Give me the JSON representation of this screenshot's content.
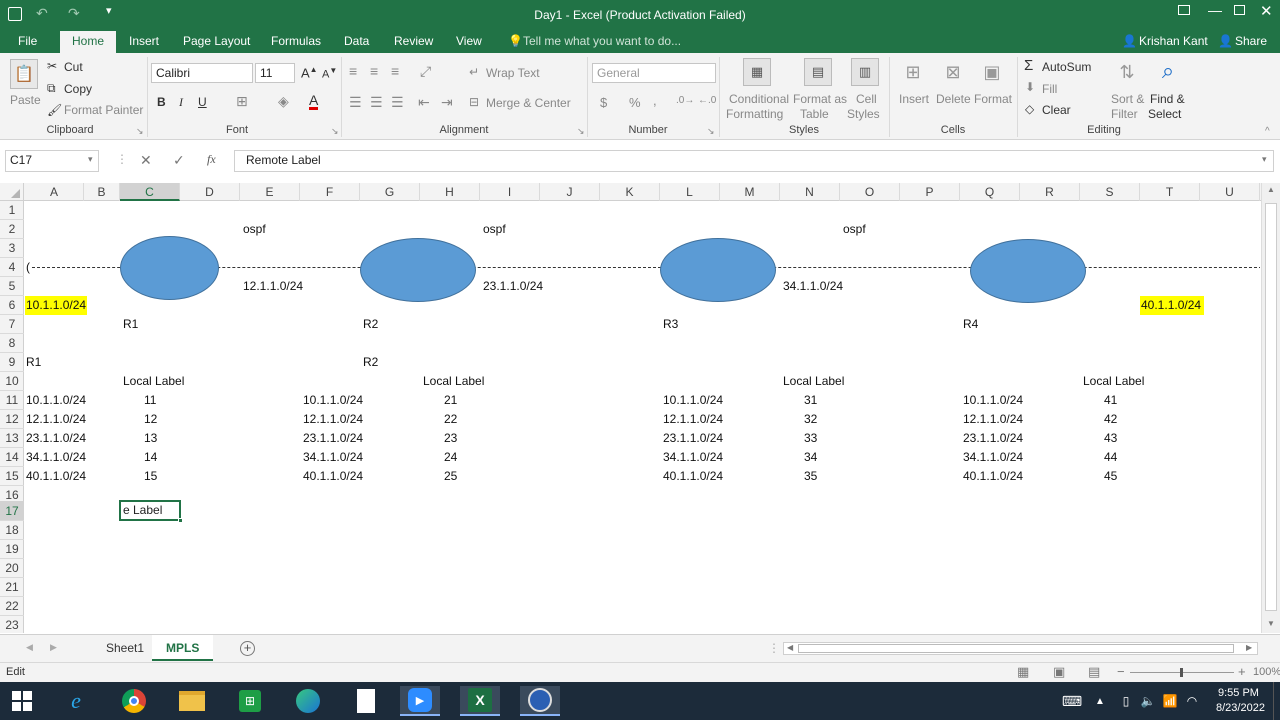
{
  "window": {
    "title": "Day1 - Excel (Product Activation Failed)"
  },
  "ribbon_tabs": [
    "File",
    "Home",
    "Insert",
    "Page Layout",
    "Formulas",
    "Data",
    "Review",
    "View"
  ],
  "active_tab": "Home",
  "tell_me": "Tell me what you want to do...",
  "user": {
    "name": "Krishan Kant",
    "share": "Share"
  },
  "clipboard": {
    "paste": "Paste",
    "cut": "Cut",
    "copy": "Copy",
    "format_painter": "Format Painter",
    "label": "Clipboard"
  },
  "font": {
    "name": "Calibri",
    "size": "11",
    "label": "Font",
    "bold": "B",
    "italic": "I",
    "underline": "U"
  },
  "alignment": {
    "wrap_text": "Wrap Text",
    "merge_center": "Merge & Center",
    "label": "Alignment"
  },
  "number": {
    "format": "General",
    "label": "Number",
    "currency": "$",
    "percent": "%"
  },
  "styles": {
    "conditional": [
      "Conditional",
      "Formatting"
    ],
    "format_as_table": [
      "Format as",
      "Table"
    ],
    "cell_styles": [
      "Cell",
      "Styles"
    ],
    "label": "Styles"
  },
  "cells": {
    "insert": "Insert",
    "delete": "Delete",
    "format": "Format",
    "label": "Cells"
  },
  "editing": {
    "autosum": "AutoSum",
    "fill": "Fill",
    "clear": "Clear",
    "sort_filter": [
      "Sort &",
      "Filter"
    ],
    "find_select": [
      "Find &",
      "Select"
    ],
    "label": "Editing"
  },
  "formula_bar": {
    "name_box": "C17",
    "fx": "fx",
    "content": "Remote Label"
  },
  "columns": [
    "A",
    "B",
    "C",
    "D",
    "E",
    "F",
    "G",
    "H",
    "I",
    "J",
    "K",
    "L",
    "M",
    "N",
    "O",
    "P",
    "Q",
    "R",
    "S",
    "T",
    "U"
  ],
  "selected_column": "C",
  "rows": [
    "1",
    "2",
    "3",
    "4",
    "5",
    "6",
    "7",
    "8",
    "9",
    "10",
    "11",
    "12",
    "13",
    "14",
    "15",
    "16",
    "17",
    "18",
    "19",
    "20",
    "21",
    "22",
    "23"
  ],
  "selected_row": "17",
  "diagram": {
    "ospf_labels": [
      "ospf",
      "ospf",
      "ospf"
    ],
    "link_subnets": [
      "12.1.1.0/24",
      "23.1.1.0/24",
      "34.1.1.0/24"
    ],
    "edge_subnets": [
      "10.1.1.0/24",
      "40.1.1.0/24"
    ],
    "routers": [
      "R1",
      "R2",
      "R3",
      "R4"
    ],
    "highlight_color": "#ffff00",
    "router_color": "#5b9bd5",
    "dash_start": "("
  },
  "tables": {
    "title_left": "R1",
    "title_r2": "R2",
    "header": "Local Label",
    "prefixes": [
      "10.1.1.0/24",
      "12.1.1.0/24",
      "23.1.1.0/24",
      "34.1.1.0/24",
      "40.1.1.0/24"
    ],
    "r1_labels": [
      "11",
      "12",
      "13",
      "14",
      "15"
    ],
    "r2_labels": [
      "21",
      "22",
      "23",
      "24",
      "25"
    ],
    "r3_labels": [
      "31",
      "32",
      "33",
      "34",
      "35"
    ],
    "r4_labels": [
      "41",
      "42",
      "43",
      "44",
      "45"
    ]
  },
  "active_cell": {
    "text": "e Label"
  },
  "sheets": [
    "Sheet1",
    "MPLS"
  ],
  "active_sheet": "MPLS",
  "status": {
    "mode": "Edit",
    "zoom": "100%"
  },
  "taskbar": {
    "time": "9:55 PM",
    "date": "8/23/2022"
  }
}
